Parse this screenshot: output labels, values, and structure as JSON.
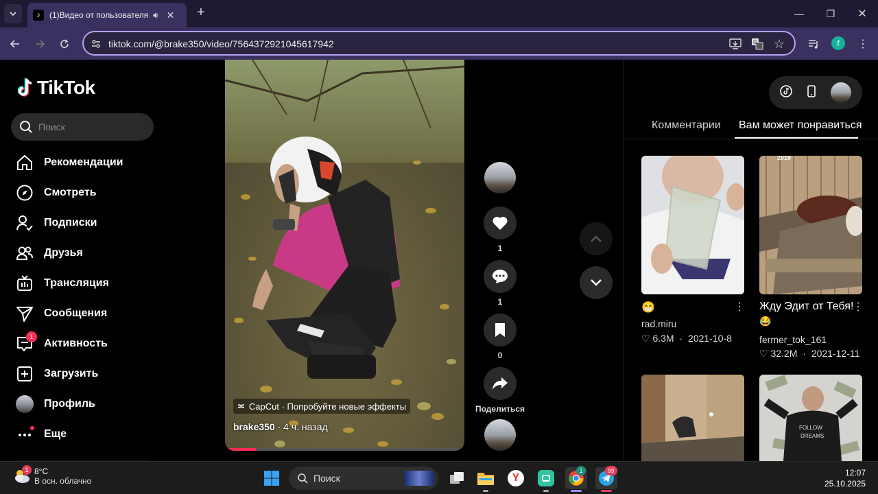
{
  "browser": {
    "tab_title": "(1)Видео от пользователя",
    "url": "tiktok.com/@brake350/video/7564372921045617942",
    "profile_letter": "f"
  },
  "sidebar": {
    "logo": "TikTok",
    "search_placeholder": "Поиск",
    "items": [
      {
        "label": "Рекомендации",
        "icon": "home-icon"
      },
      {
        "label": "Смотреть",
        "icon": "compass-icon"
      },
      {
        "label": "Подписки",
        "icon": "following-icon"
      },
      {
        "label": "Друзья",
        "icon": "friends-icon"
      },
      {
        "label": "Трансляция",
        "icon": "live-icon"
      },
      {
        "label": "Сообщения",
        "icon": "messages-icon"
      },
      {
        "label": "Активность",
        "icon": "activity-icon",
        "badge": "1"
      },
      {
        "label": "Загрузить",
        "icon": "upload-icon"
      },
      {
        "label": "Профиль",
        "icon": "profile-icon"
      },
      {
        "label": "Еще",
        "icon": "more-icon"
      }
    ]
  },
  "video": {
    "capcut_label": "CapCut · Попробуйте новые эффекты",
    "author": "brake350",
    "time_ago": "· 4 ч. назад",
    "progress": 0.13
  },
  "actions": {
    "likes": "1",
    "comments": "1",
    "bookmarks": "0",
    "share_label": "Поделиться"
  },
  "right_panel": {
    "tabs": [
      "Комментарии",
      "Вам может понравиться"
    ],
    "cards": [
      {
        "title": "😁",
        "user": "rad.miru",
        "likes": "6.3M",
        "date": "2021-10-8"
      },
      {
        "title": "Жду Эдит от Тебя!",
        "emoji": "😂",
        "user": "fermer_tok_161",
        "likes": "32.2M",
        "date": "2021-12-11",
        "overlay": "2019"
      }
    ]
  },
  "taskbar": {
    "temperature": "8°C",
    "condition": "В осн. облачно",
    "weather_badge": "1",
    "search_placeholder": "Поиск",
    "time": "12:07",
    "date": "25.10.2025",
    "chrome_badge": "1",
    "telegram_badge": "99"
  }
}
